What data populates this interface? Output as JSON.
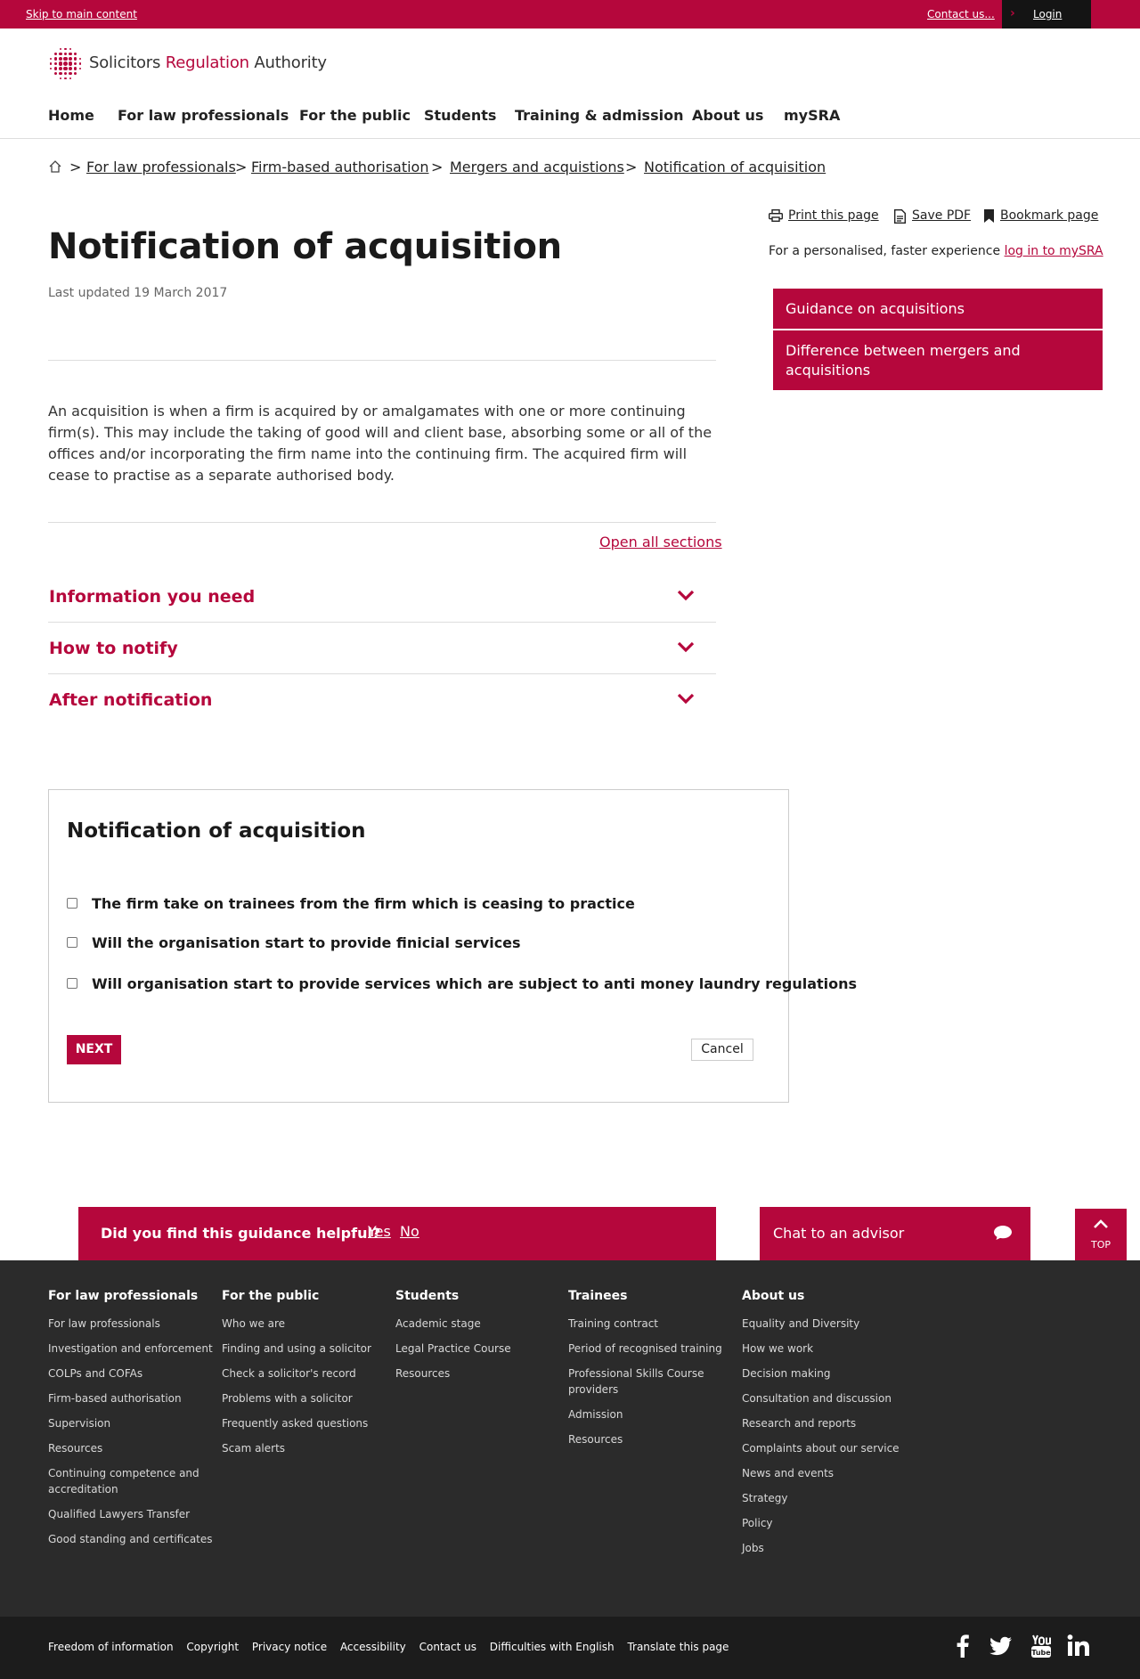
{
  "topbar": {
    "skip_link": "Skip to main content",
    "contact": "Contact us...",
    "login": "Login"
  },
  "brand": {
    "name_1": "Solicitors",
    "name_2": "Regulation",
    "name_3": "Authority",
    "accent": "#b5073c"
  },
  "nav": {
    "items": [
      "Home",
      "For law professionals",
      "For the public",
      "Students",
      "Training & admission",
      "About us",
      "mySRA"
    ]
  },
  "breadcrumb": {
    "items": [
      "For law professionals",
      "Firm-based authorisation",
      "Mergers and acquistions",
      "Notification of acquisition"
    ],
    "separator": ">"
  },
  "page_tools": {
    "print": "Print this page",
    "save_pdf": "Save PDF",
    "bookmark": "Bookmark page",
    "personalised_text": "For a personalised, faster experience",
    "login_link": "log in to mySRA"
  },
  "sidebar": {
    "links": [
      "Guidance on acquisitions",
      "Difference between mergers and acquisitions"
    ]
  },
  "main": {
    "title": "Notification of acquisition",
    "last_updated": "Last updated 19 March 2017",
    "intro": "An acquisition is when a firm is acquired by or amalgamates with one or more continuing firm(s). This may include the taking of good will and client base, absorbing some or all of the offices and/or incorporating the firm name into the continuing firm. The acquired firm will cease to practise as a separate authorised body.",
    "open_all": "Open all sections",
    "sections": [
      "Information you need",
      "How to notify",
      "After notification"
    ]
  },
  "form": {
    "title": "Notification of acquisition",
    "options": [
      "The firm take on trainees from the firm which is ceasing to practice",
      "Will the organisation start to provide finicial services",
      "Will organisation start to provide services which are subject to anti money laundry regulations"
    ],
    "next_label": "NEXT",
    "cancel_label": "Cancel"
  },
  "feedback": {
    "question": "Did you find this guidance helpful?",
    "yes": "Yes",
    "no": "No",
    "chat": "Chat to an advisor",
    "top": "TOP"
  },
  "footer": {
    "columns": [
      {
        "heading": "For law professionals",
        "links": [
          "For law professionals",
          "Investigation and enforcement",
          "COLPs and COFAs",
          "Firm-based authorisation",
          "Supervision",
          "Resources",
          "Continuing competence and accreditation",
          "Qualified Lawyers Transfer",
          "Good standing and certificates"
        ]
      },
      {
        "heading": "For the public",
        "links": [
          "Who we are",
          "Finding and using a solicitor",
          "Check a solicitor's record",
          "Problems with a solicitor",
          "Frequently asked questions",
          "Scam alerts"
        ]
      },
      {
        "heading": "Students",
        "links": [
          "Academic stage",
          "Legal Practice Course",
          "Resources"
        ]
      },
      {
        "heading": "Trainees",
        "links": [
          "Training contract",
          "Period of recognised training",
          "Professional Skills Course providers",
          "Admission",
          "Resources"
        ]
      },
      {
        "heading": "About us",
        "links": [
          "Equality and Diversity",
          "How we work",
          "Decision making",
          "Consultation and discussion",
          "Research and reports",
          "Complaints about our service",
          "News and events",
          "Strategy",
          "Policy",
          "Jobs"
        ]
      }
    ],
    "bottom_links": [
      "Freedom of information",
      "Copyright",
      "Privacy notice",
      "Accessibility",
      "Contact us",
      "Difficulties with English",
      "Translate this page"
    ],
    "social_icons": [
      "facebook-icon",
      "twitter-icon",
      "youtube-icon",
      "linkedin-icon"
    ]
  }
}
